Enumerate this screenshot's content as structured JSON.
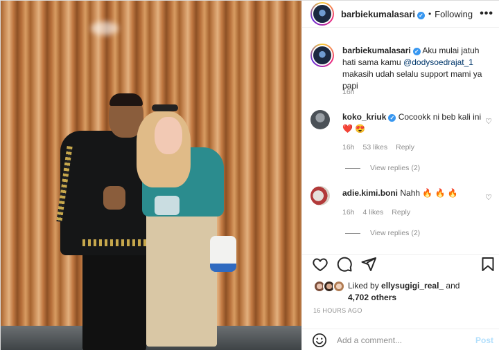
{
  "post": {
    "username": "barbiekumalasari",
    "verified": true,
    "follow_sep": "•",
    "follow_status": "Following",
    "more_label": "•••"
  },
  "caption": {
    "username": "barbiekumalasari",
    "text_before": "Aku mulai jatuh hati sama kamu ",
    "mention": "@dodysoedrajat_1",
    "text_after": " makasih udah selalu support mami ya papi",
    "time": "16h"
  },
  "comments": [
    {
      "username": "koko_kriuk",
      "verified": true,
      "text": "Cocookk ni beb kali ini ❤️ 😍",
      "time": "16h",
      "likes": "53 likes",
      "reply": "Reply",
      "view_replies": "View replies (2)"
    },
    {
      "username": "adie.kimi.boni",
      "verified": false,
      "text": "Nahh 🔥 🔥 🔥",
      "time": "16h",
      "likes": "4 likes",
      "reply": "Reply",
      "view_replies": "View replies (2)"
    }
  ],
  "likes": {
    "prefix": "Liked by ",
    "user": "ellysugigi_real_",
    "middle": " and",
    "others": "4,702 others"
  },
  "timestamp": "16 HOURS AGO",
  "add_comment": {
    "placeholder": "Add a comment...",
    "post_label": "Post"
  },
  "icons": {
    "emoji": "smiley-icon",
    "like": "heart-icon",
    "comment": "comment-icon",
    "share": "send-icon",
    "save": "bookmark-icon"
  },
  "colors": {
    "verified": "#3897f0",
    "muted": "#8e8e8e",
    "post_disabled": "#b2dffc",
    "mention": "#00376b"
  }
}
